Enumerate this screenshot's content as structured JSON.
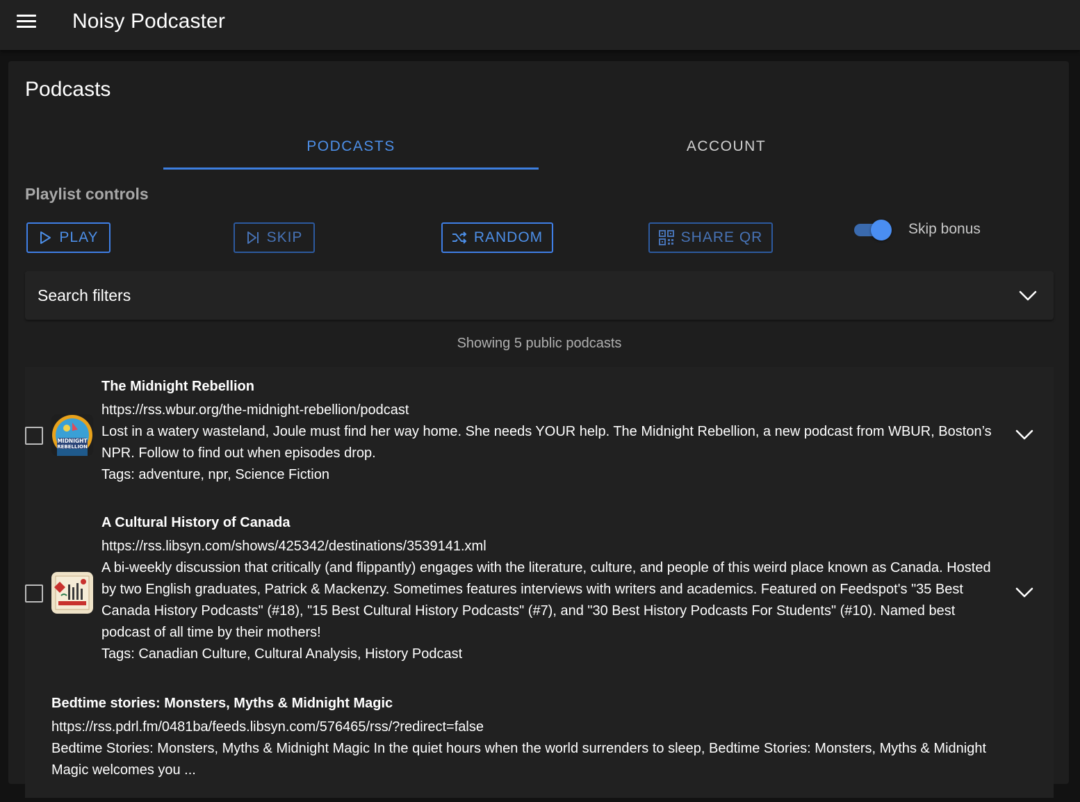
{
  "app": {
    "title": "Noisy Podcaster"
  },
  "card": {
    "title": "Podcasts"
  },
  "tabs": [
    {
      "label": "PODCASTS",
      "active": true
    },
    {
      "label": "ACCOUNT",
      "active": false
    }
  ],
  "playlist": {
    "section_label": "Playlist controls",
    "play_label": "PLAY",
    "skip_label": "SKIP",
    "random_label": "RANDOM",
    "share_label": "SHARE QR",
    "skip_bonus_label": "Skip bonus",
    "skip_bonus_on": true
  },
  "filters": {
    "label": "Search filters"
  },
  "results": {
    "summary": "Showing 5 public podcasts"
  },
  "podcasts": [
    {
      "title": "The Midnight Rebellion",
      "url": "https://rss.wbur.org/the-midnight-rebellion/podcast",
      "description": "Lost in a watery wasteland, Joule must find her way home. She needs YOUR help. The Midnight Rebellion, a new podcast from WBUR, Boston’s NPR. Follow to find out when episodes drop.",
      "tags": "Tags: adventure, npr, Science Fiction",
      "thumb_text": "MIDNIGHT REBELLION"
    },
    {
      "title": "A Cultural History of Canada",
      "url": "https://rss.libsyn.com/shows/425342/destinations/3539141.xml",
      "description": "A bi-weekly discussion that critically (and flippantly) engages with the literature, culture, and people of this weird place known as Canada. Hosted by two English graduates, Patrick & Mackenzy. Sometimes features interviews with writers and academics. Featured on Feedspot's \"35 Best Canada History Podcasts\" (#18), \"15 Best Cultural History Podcasts\" (#7), and \"30 Best History Podcasts For Students\" (#10). Named best podcast of all time by their mothers!",
      "tags": "Tags: Canadian Culture, Cultural Analysis, History Podcast"
    },
    {
      "title": "Bedtime stories: Monsters, Myths & Midnight Magic",
      "url": "https://rss.pdrl.fm/0481ba/feeds.libsyn.com/576465/rss/?redirect=false",
      "description": "Bedtime Stories: Monsters, Myths & Midnight Magic In the quiet hours when the world surrenders to sleep, Bedtime Stories: Monsters, Myths & Midnight Magic welcomes you ..."
    }
  ],
  "colors": {
    "accent": "#4d8fe8",
    "background": "#121212",
    "surface": "#1e1e1e",
    "appbar": "#212121"
  }
}
